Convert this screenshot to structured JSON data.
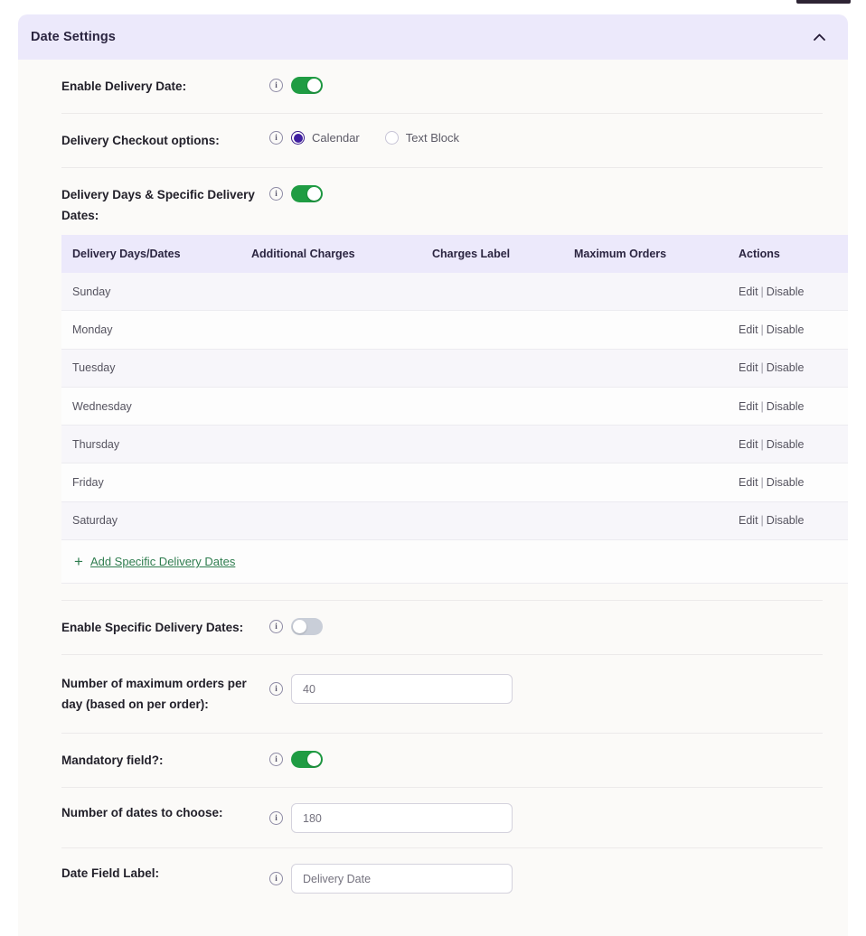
{
  "card": {
    "header": {
      "title": "Date Settings",
      "collapse_icon": "chevron-up-icon"
    }
  },
  "settings": {
    "enable_delivery_date": {
      "label": "Enable Delivery Date:",
      "info_icon": "info-icon",
      "toggle_state": "on"
    },
    "delivery_checkout_options": {
      "label": "Delivery Checkout options:",
      "info_icon": "info-icon",
      "options": [
        {
          "label": "Calendar",
          "checked": true
        },
        {
          "label": "Text Block",
          "checked": false
        }
      ]
    },
    "delivery_days": {
      "label": "Delivery Days & Specific Delivery Dates:",
      "info_icon": "info-icon",
      "toggle_state": "on"
    },
    "enable_specific_dates": {
      "label": "Enable Specific Delivery Dates:",
      "info_icon": "info-icon",
      "toggle_state": "off"
    },
    "max_orders_per_day": {
      "label": "Number of maximum orders per day (based on per order):",
      "info_icon": "info-icon",
      "value": "40",
      "placeholder": "40"
    },
    "mandatory_field": {
      "label": "Mandatory field?:",
      "info_icon": "info-icon",
      "toggle_state": "on"
    },
    "number_of_dates": {
      "label": "Number of dates to choose:",
      "info_icon": "info-icon",
      "value": "180",
      "placeholder": "180"
    },
    "date_field_label": {
      "label": "Date Field Label:",
      "info_icon": "info-icon",
      "value": "Delivery Date",
      "placeholder": "Delivery Date"
    }
  },
  "table": {
    "columns": [
      "Delivery Days/Dates",
      "Additional Charges",
      "Charges Label",
      "Maximum Orders",
      "Actions"
    ],
    "rows": [
      {
        "day": "Sunday",
        "additional_charges": "",
        "charges_label": "",
        "maximum_orders": "",
        "edit": "Edit",
        "separator": "|",
        "disable": "Disable"
      },
      {
        "day": "Monday",
        "additional_charges": "",
        "charges_label": "",
        "maximum_orders": "",
        "edit": "Edit",
        "separator": "|",
        "disable": "Disable"
      },
      {
        "day": "Tuesday",
        "additional_charges": "",
        "charges_label": "",
        "maximum_orders": "",
        "edit": "Edit",
        "separator": "|",
        "disable": "Disable"
      },
      {
        "day": "Wednesday",
        "additional_charges": "",
        "charges_label": "",
        "maximum_orders": "",
        "edit": "Edit",
        "separator": "|",
        "disable": "Disable"
      },
      {
        "day": "Thursday",
        "additional_charges": "",
        "charges_label": "",
        "maximum_orders": "",
        "edit": "Edit",
        "separator": "|",
        "disable": "Disable"
      },
      {
        "day": "Friday",
        "additional_charges": "",
        "charges_label": "",
        "maximum_orders": "",
        "edit": "Edit",
        "separator": "|",
        "disable": "Disable"
      },
      {
        "day": "Saturday",
        "additional_charges": "",
        "charges_label": "",
        "maximum_orders": "",
        "edit": "Edit",
        "separator": "|",
        "disable": "Disable"
      }
    ],
    "add_link": {
      "plus_icon": "plus-icon",
      "label": " Add Specific Delivery Dates"
    }
  },
  "colors": {
    "header_bg": "#ece9fb",
    "toggle_on": "#1f9c43",
    "toggle_off": "#c9ced8",
    "radio_accent": "#3f1ea0",
    "link_green": "#2f7d4f",
    "card_bg": "#fbfaf8"
  }
}
